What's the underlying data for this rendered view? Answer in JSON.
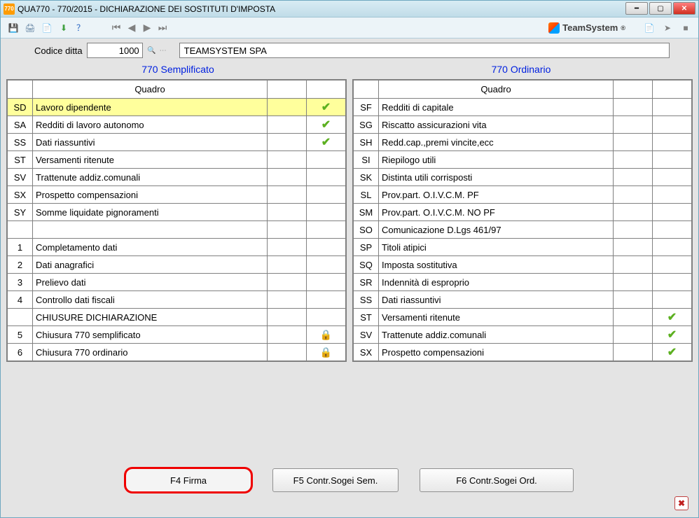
{
  "window": {
    "app_code": "770",
    "title": "QUA770  - 770/2015 -   DICHIARAZIONE DEI SOSTITUTI D'IMPOSTA"
  },
  "toolbar": {
    "brand": "TeamSystem"
  },
  "codice": {
    "label": "Codice ditta",
    "value": "1000",
    "company": "TEAMSYSTEM SPA"
  },
  "headers": {
    "left": "770 Semplificato",
    "right": "770 Ordinario"
  },
  "table_header": "Quadro",
  "left_rows": [
    {
      "code": "SD",
      "desc": "Lavoro dipendente",
      "check": true,
      "selected": true
    },
    {
      "code": "SA",
      "desc": "Redditi di lavoro autonomo",
      "check": true
    },
    {
      "code": "SS",
      "desc": "Dati riassuntivi",
      "check": true
    },
    {
      "code": "ST",
      "desc": "Versamenti ritenute"
    },
    {
      "code": "SV",
      "desc": "Trattenute addiz.comunali"
    },
    {
      "code": "SX",
      "desc": "Prospetto compensazioni"
    },
    {
      "code": "SY",
      "desc": "Somme liquidate pignoramenti"
    },
    {
      "code": "",
      "desc": ""
    },
    {
      "code": "1",
      "desc": "Completamento dati"
    },
    {
      "code": "2",
      "desc": "Dati anagrafici"
    },
    {
      "code": "3",
      "desc": "Prelievo dati"
    },
    {
      "code": "4",
      "desc": "Controllo dati fiscali"
    },
    {
      "code": "",
      "desc": "CHIUSURE DICHIARAZIONE"
    },
    {
      "code": "5",
      "desc": "Chiusura 770 semplificato",
      "lock": true
    },
    {
      "code": "6",
      "desc": "Chiusura 770 ordinario",
      "lock": true
    }
  ],
  "right_rows": [
    {
      "code": "SF",
      "desc": "Redditi di capitale"
    },
    {
      "code": "SG",
      "desc": "Riscatto assicurazioni vita"
    },
    {
      "code": "SH",
      "desc": "Redd.cap.,premi vincite,ecc"
    },
    {
      "code": "SI",
      "desc": "Riepilogo utili"
    },
    {
      "code": "SK",
      "desc": "Distinta utili corrisposti"
    },
    {
      "code": "SL",
      "desc": "Prov.part. O.I.V.C.M. PF"
    },
    {
      "code": "SM",
      "desc": "Prov.part. O.I.V.C.M. NO PF"
    },
    {
      "code": "SO",
      "desc": "Comunicazione D.Lgs 461/97"
    },
    {
      "code": "SP",
      "desc": "Titoli atipici"
    },
    {
      "code": "SQ",
      "desc": "Imposta sostitutiva"
    },
    {
      "code": "SR",
      "desc": "Indennità di esproprio"
    },
    {
      "code": "SS",
      "desc": "Dati riassuntivi"
    },
    {
      "code": "ST",
      "desc": "Versamenti ritenute",
      "check": true
    },
    {
      "code": "SV",
      "desc": "Trattenute addiz.comunali",
      "check": true
    },
    {
      "code": "SX",
      "desc": "Prospetto compensazioni",
      "check": true
    }
  ],
  "buttons": {
    "firma": "F4 Firma",
    "sogei_sem": "F5 Contr.Sogei Sem.",
    "sogei_ord": "F6 Contr.Sogei Ord."
  }
}
